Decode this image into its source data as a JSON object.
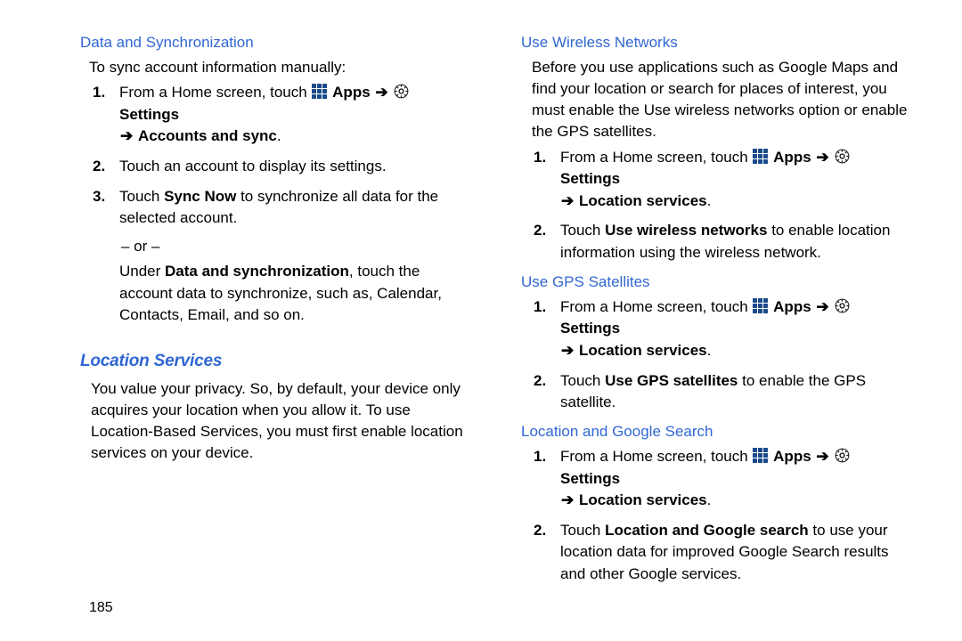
{
  "page_number": "185",
  "left": {
    "h_dataSync": "Data and Synchronization",
    "p_sync": "To sync account information manually:",
    "step1_pre": "From a Home screen, touch ",
    "apps": "Apps",
    "settings": "Settings",
    "accounts_sync": "Accounts and sync",
    "step2": "Touch an account to display its settings.",
    "step3_pre": "Touch ",
    "step3_bold": "Sync Now",
    "step3_post": " to synchronize all data for the selected account.",
    "or": "– or –",
    "under_pre": "Under ",
    "under_bold": "Data and synchronization",
    "under_post": ", touch the account data to synchronize, such as, Calendar, Contacts, Email, and so on.",
    "h_location": "Location Services",
    "p_location": "You value your privacy. So, by default, your device only acquires your location when you allow it. To use Location-Based Services, you must first enable location services on your device."
  },
  "right": {
    "h_wireless": "Use Wireless Networks",
    "p_wireless": "Before you use applications such as Google Maps and find your location or search for places of interest, you must enable the Use wireless networks option or enable the GPS satellites.",
    "step1_pre": "From a Home screen, touch ",
    "apps": "Apps",
    "settings": "Settings",
    "location_services": "Location services",
    "w_step2_pre": "Touch ",
    "w_step2_bold": "Use wireless networks",
    "w_step2_post": " to enable location information using the wireless network.",
    "h_gps": "Use GPS Satellites",
    "g_step2_pre": "Touch ",
    "g_step2_bold": "Use GPS satellites",
    "g_step2_post": " to enable the GPS satellite.",
    "h_google": "Location and Google Search",
    "go_step2_pre": "Touch ",
    "go_step2_bold": "Location and Google search",
    "go_step2_post": " to use your location data for improved Google Search results and other Google services."
  },
  "period": "."
}
